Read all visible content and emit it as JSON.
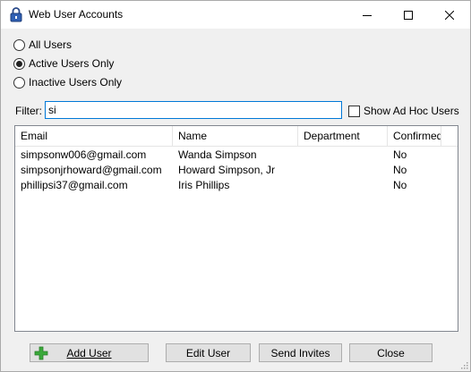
{
  "window": {
    "title": "Web User Accounts"
  },
  "filters": {
    "options": [
      {
        "label": "All Users",
        "checked": false
      },
      {
        "label": "Active Users Only",
        "checked": true
      },
      {
        "label": "Inactive Users Only",
        "checked": false
      }
    ],
    "filter_label": "Filter:",
    "filter_value": "si",
    "show_ad_hoc_label": "Show Ad Hoc Users",
    "show_ad_hoc_checked": false
  },
  "list": {
    "columns": [
      "Email",
      "Name",
      "Department",
      "Confirmed"
    ],
    "rows": [
      {
        "email": "simpsonw006@gmail.com",
        "name": "Wanda Simpson",
        "department": "",
        "confirmed": "No"
      },
      {
        "email": "simpsonjrhoward@gmail.com",
        "name": "Howard Simpson, Jr",
        "department": "",
        "confirmed": "No"
      },
      {
        "email": "phillipsi37@gmail.com",
        "name": "Iris Phillips",
        "department": "",
        "confirmed": "No"
      }
    ]
  },
  "buttons": {
    "add_user": "Add User",
    "edit_user": "Edit User",
    "send_invites": "Send Invites",
    "close": "Close"
  },
  "icons": {
    "app": "padlock-icon",
    "add": "green-plus-icon"
  },
  "colors": {
    "focus_border": "#0078d7",
    "window_bg": "#f0f0f0",
    "plus_green": "#3aa93a"
  }
}
